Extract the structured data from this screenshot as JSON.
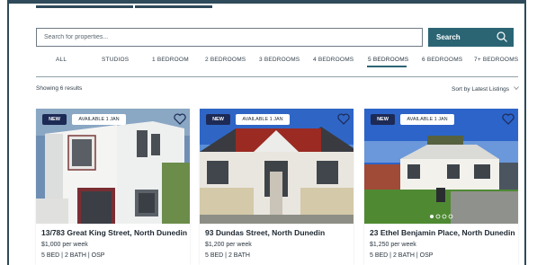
{
  "search": {
    "placeholder": "Search for properties...",
    "button_label": "Search"
  },
  "tabs": [
    {
      "label": "ALL"
    },
    {
      "label": "STUDIOS"
    },
    {
      "label": "1 BEDROOM"
    },
    {
      "label": "2 BEDROOMS"
    },
    {
      "label": "3 BEDROOMS"
    },
    {
      "label": "4 BEDROOMS"
    },
    {
      "label": "5 BEDROOMS",
      "active": true
    },
    {
      "label": "6 BEDROOMS"
    },
    {
      "label": "7+ BEDROOMS"
    }
  ],
  "results": {
    "count_text": "Showing 6 results",
    "sort_label": "Sort by Latest Listings"
  },
  "listings": [
    {
      "badge_new": "NEW",
      "badge_available": "AVAILABLE 1 JAN",
      "title": "13/783 Great King Street, North Dunedin",
      "price": "$1,000 per week",
      "features": "5 BED | 2 BATH | OSP"
    },
    {
      "badge_new": "NEW",
      "badge_available": "AVAILABLE 1 JAN",
      "title": "93 Dundas Street, North Dunedin",
      "price": "$1,200 per week",
      "features": "5 BED | 2 BATH"
    },
    {
      "badge_new": "NEW",
      "badge_available": "AVAILABLE 1 JAN",
      "title": "23 Ethel Benjamin Place, North Dunedin",
      "price": "$1,250 per week",
      "features": "5 BED | 2 BATH | OSP"
    }
  ],
  "colors": {
    "accent": "#2b6574",
    "badge_new_bg": "#1d2a55",
    "frame": "#2f4a5a"
  },
  "icons": {
    "search_button": "search-icon",
    "sort": "chevron-down-icon",
    "favourite": "heart-icon"
  }
}
